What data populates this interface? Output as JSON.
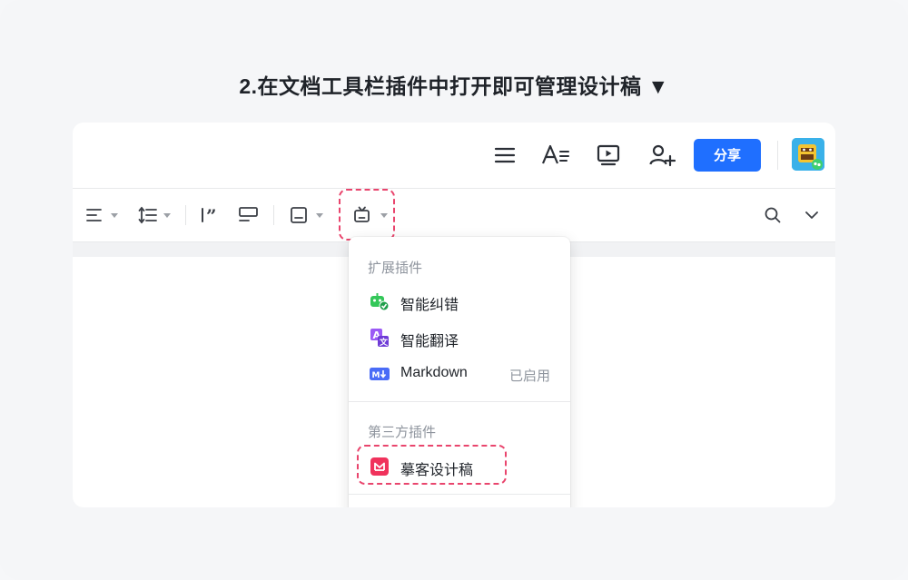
{
  "heading": "2.在文档工具栏插件中打开即可管理设计稿 ▼",
  "topbar": {
    "icons": [
      "menu-icon",
      "text-format-icon",
      "present-icon",
      "add-member-icon"
    ],
    "share_label": "分享",
    "share_color": "#1f6fff",
    "avatar": "avatar-icon"
  },
  "toolbar": {
    "tools": [
      "align-icon",
      "line-spacing-icon",
      "quote-icon",
      "callout-icon",
      "block-icon",
      "plugin-icon",
      "search-icon",
      "chevron-down-icon"
    ],
    "highlight_color": "#e9456d"
  },
  "plugin_menu": {
    "ext_section": "扩展插件",
    "items": [
      {
        "label": "智能纠错",
        "icon": "smart-correct-icon",
        "status": ""
      },
      {
        "label": "智能翻译",
        "icon": "translate-icon",
        "status": ""
      },
      {
        "label": "Markdown",
        "icon": "markdown-icon",
        "status": "已启用"
      }
    ],
    "third_section": "第三方插件",
    "third_items": [
      {
        "label": "摹客设计稿",
        "icon": "mockplus-icon"
      }
    ]
  }
}
